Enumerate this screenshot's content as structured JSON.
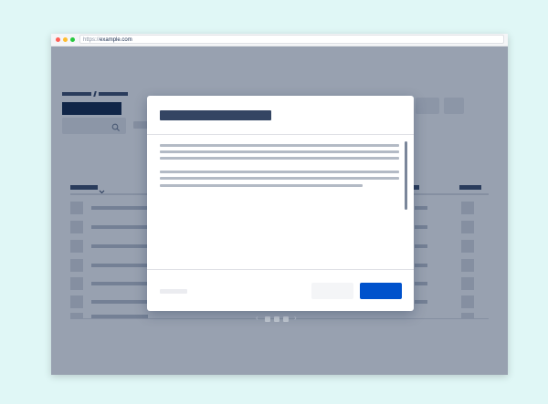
{
  "browser": {
    "url_scheme": "https://",
    "url_host": "example.com"
  },
  "modal": {
    "primary_button_color": "#0052cc",
    "title_color": "#344563"
  },
  "overlay_color": "rgba(9, 30, 66, 0.42)",
  "icons": {
    "search": "magnifier-icon",
    "sort": "chevron-down-icon",
    "pager_prev": "chevron-left-icon",
    "pager_next": "chevron-right-icon"
  },
  "pager_prev_glyph": "‹",
  "pager_next_glyph": "›"
}
